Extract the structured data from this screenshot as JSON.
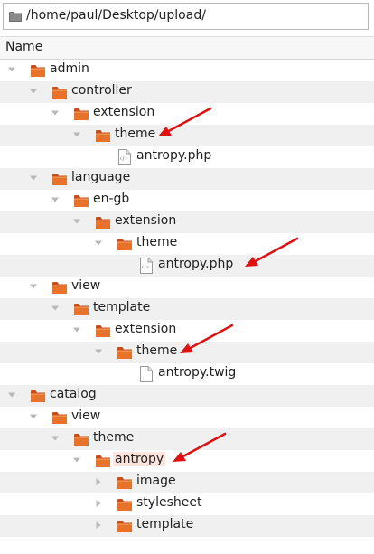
{
  "path_bar": {
    "path": "/home/paul/Desktop/upload/"
  },
  "column_header": {
    "name": "Name"
  },
  "tree_rows": [
    {
      "label": "admin",
      "depth": 0,
      "type": "folder",
      "expanded": true
    },
    {
      "label": "controller",
      "depth": 1,
      "type": "folder",
      "expanded": true
    },
    {
      "label": "extension",
      "depth": 2,
      "type": "folder",
      "expanded": true
    },
    {
      "label": "theme",
      "depth": 3,
      "type": "folder",
      "expanded": true,
      "arrow": true
    },
    {
      "label": "antropy.php",
      "depth": 4,
      "type": "php-file"
    },
    {
      "label": "language",
      "depth": 1,
      "type": "folder",
      "expanded": true
    },
    {
      "label": "en-gb",
      "depth": 2,
      "type": "folder",
      "expanded": true
    },
    {
      "label": "extension",
      "depth": 3,
      "type": "folder",
      "expanded": true
    },
    {
      "label": "theme",
      "depth": 4,
      "type": "folder",
      "expanded": true
    },
    {
      "label": "antropy.php",
      "depth": 5,
      "type": "php-file",
      "arrow": true
    },
    {
      "label": "view",
      "depth": 1,
      "type": "folder",
      "expanded": true
    },
    {
      "label": "template",
      "depth": 2,
      "type": "folder",
      "expanded": true
    },
    {
      "label": "extension",
      "depth": 3,
      "type": "folder",
      "expanded": true
    },
    {
      "label": "theme",
      "depth": 4,
      "type": "folder",
      "expanded": true,
      "arrow": true
    },
    {
      "label": "antropy.twig",
      "depth": 5,
      "type": "text-file"
    },
    {
      "label": "catalog",
      "depth": 0,
      "type": "folder",
      "expanded": true
    },
    {
      "label": "view",
      "depth": 1,
      "type": "folder",
      "expanded": true
    },
    {
      "label": "theme",
      "depth": 2,
      "type": "folder",
      "expanded": true
    },
    {
      "label": "antropy",
      "depth": 3,
      "type": "folder",
      "expanded": true,
      "highlighted": true,
      "arrow": true
    },
    {
      "label": "image",
      "depth": 4,
      "type": "folder",
      "expanded": false
    },
    {
      "label": "stylesheet",
      "depth": 4,
      "type": "folder",
      "expanded": false
    },
    {
      "label": "template",
      "depth": 4,
      "type": "folder",
      "expanded": false
    }
  ],
  "colors": {
    "folder_body": "#e8722a",
    "folder_tab": "#c4501b",
    "arrow": "#e01010",
    "highlight": "#fde4dc",
    "alt_row": "#f0f0f0"
  },
  "icons": {
    "path": "folder-icon",
    "folder": "folder-icon",
    "php_file": "php-file-icon",
    "text_file": "text-file-icon",
    "expanded": "triangle-down-icon",
    "collapsed": "triangle-right-icon"
  }
}
